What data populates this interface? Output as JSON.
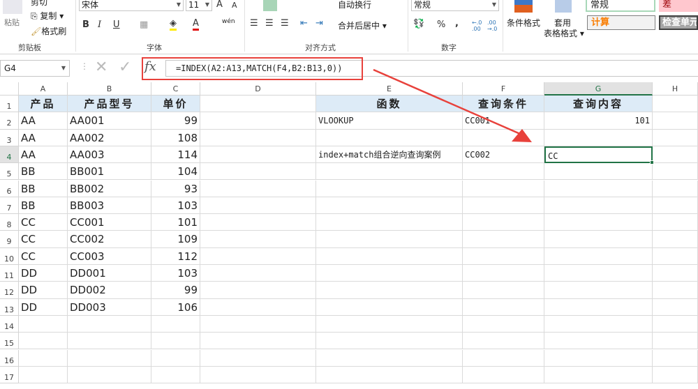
{
  "ribbon": {
    "clipboard": {
      "paste": "粘贴",
      "cut": "剪切",
      "copy": "复制",
      "format_painter": "格式刷",
      "group": "剪贴板"
    },
    "font": {
      "name": "宋体",
      "size": "11",
      "bold": "B",
      "italic": "I",
      "underline": "U",
      "group": "字体",
      "phonetic": "wén"
    },
    "alignment": {
      "wrap": "自动换行",
      "merge": "合并后居中",
      "group": "对齐方式"
    },
    "number": {
      "format": "常规",
      "percent": "%",
      "comma": ",",
      "inc_dec": "←.0 .00",
      "dec_dec": ".00 →.0",
      "group": "数字"
    },
    "styles": {
      "conditional": "条件格式",
      "table": "套用",
      "table2": "表格格式",
      "normal": "常规",
      "bad": "差",
      "calc": "计算",
      "check": "检查单元"
    }
  },
  "formula_bar": {
    "name_box": "G4",
    "fx": "fx",
    "formula": "=INDEX(A2:A13,MATCH(F4,B2:B13,0))"
  },
  "columns": [
    "A",
    "B",
    "C",
    "D",
    "E",
    "F",
    "G",
    "H"
  ],
  "rows": [
    "1",
    "2",
    "3",
    "4",
    "5",
    "6",
    "7",
    "8",
    "9",
    "10",
    "11",
    "12",
    "13",
    "14",
    "15",
    "16",
    "17"
  ],
  "table": {
    "headers": [
      "产品",
      "产品型号",
      "单价"
    ],
    "data": [
      [
        "AA",
        "AA001",
        "99"
      ],
      [
        "AA",
        "AA002",
        "108"
      ],
      [
        "AA",
        "AA003",
        "114"
      ],
      [
        "BB",
        "BB001",
        "104"
      ],
      [
        "BB",
        "BB002",
        "93"
      ],
      [
        "BB",
        "BB003",
        "103"
      ],
      [
        "CC",
        "CC001",
        "101"
      ],
      [
        "CC",
        "CC002",
        "109"
      ],
      [
        "CC",
        "CC003",
        "112"
      ],
      [
        "DD",
        "DD001",
        "103"
      ],
      [
        "DD",
        "DD002",
        "99"
      ],
      [
        "DD",
        "DD003",
        "106"
      ]
    ]
  },
  "lookup": {
    "headers": [
      "函数",
      "查询条件",
      "查询内容"
    ],
    "row2": [
      "VLOOKUP",
      "CC001",
      "101"
    ],
    "row4": [
      "index+match组合逆向查询案例",
      "CC002",
      "CC"
    ]
  },
  "colors": {
    "accent": "#217346",
    "header_fill": "#ddebf7",
    "annotation": "#e8413b"
  }
}
